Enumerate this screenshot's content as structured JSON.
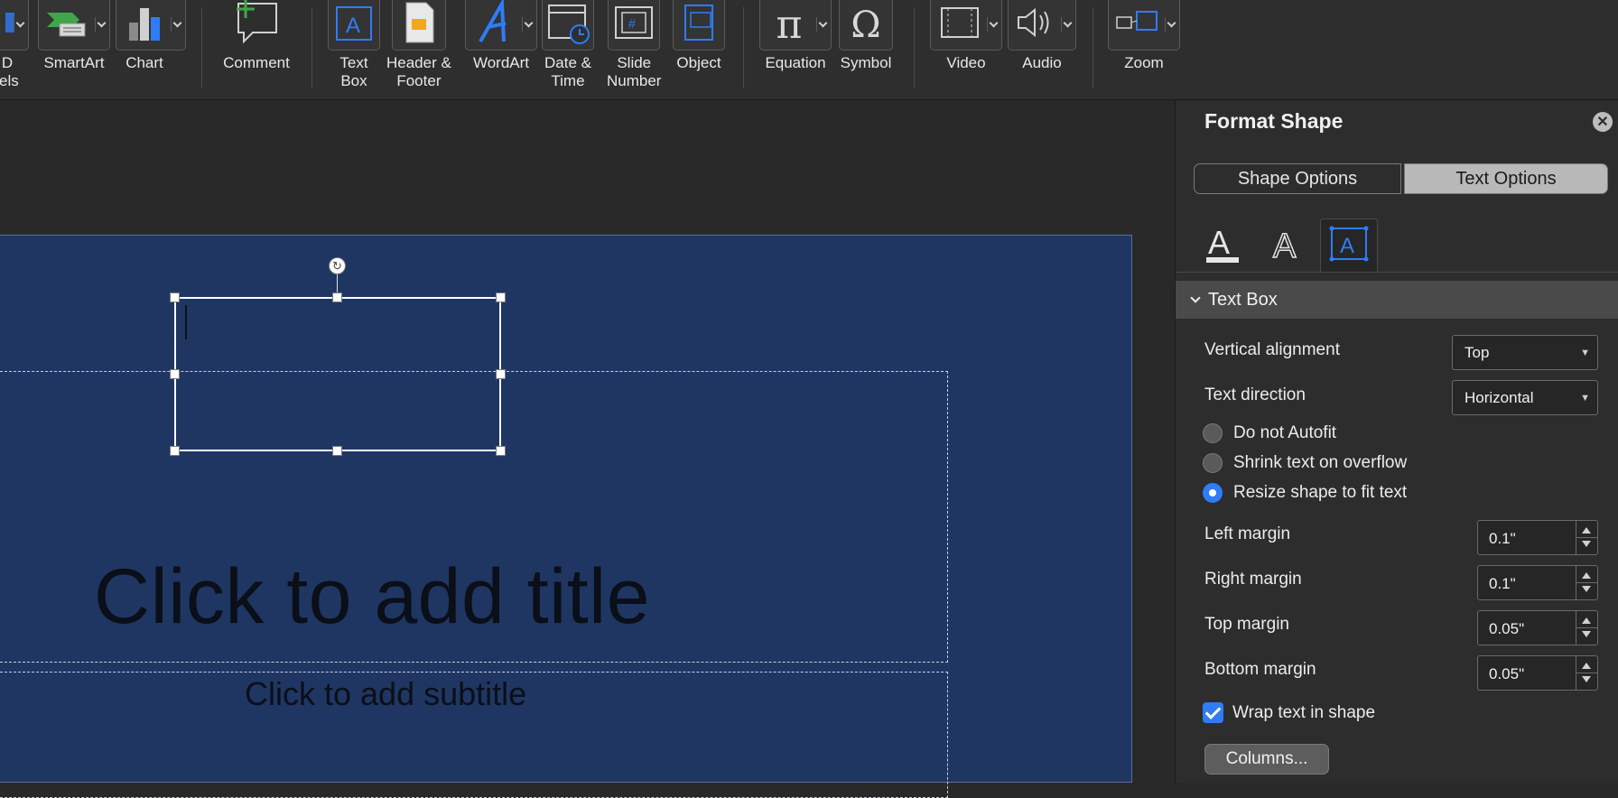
{
  "ribbon": {
    "items": [
      {
        "label": "D\nlels",
        "icon": "3d-models-icon"
      },
      {
        "label": "SmartArt",
        "icon": "smartart-icon"
      },
      {
        "label": "Chart",
        "icon": "chart-icon"
      },
      {
        "label": "Comment",
        "icon": "comment-icon"
      },
      {
        "label": "Text\nBox",
        "icon": "text-box-icon"
      },
      {
        "label": "Header &\nFooter",
        "icon": "header-footer-icon"
      },
      {
        "label": "WordArt",
        "icon": "wordart-icon"
      },
      {
        "label": "Date &\nTime",
        "icon": "date-time-icon"
      },
      {
        "label": "Slide\nNumber",
        "icon": "slide-number-icon"
      },
      {
        "label": "Object",
        "icon": "object-icon"
      },
      {
        "label": "Equation",
        "icon": "equation-icon"
      },
      {
        "label": "Symbol",
        "icon": "symbol-icon"
      },
      {
        "label": "Video",
        "icon": "video-icon"
      },
      {
        "label": "Audio",
        "icon": "audio-icon"
      },
      {
        "label": "Zoom",
        "icon": "zoom-icon"
      }
    ]
  },
  "slide": {
    "title_placeholder": "Click to add title",
    "subtitle_placeholder": "Click to add subtitle",
    "background_color": "#1f3663"
  },
  "pane": {
    "title": "Format Shape",
    "tabs": {
      "shape": "Shape Options",
      "text": "Text Options"
    },
    "section": "Text Box",
    "vertical_alignment": {
      "label": "Vertical alignment",
      "value": "Top"
    },
    "text_direction": {
      "label": "Text direction",
      "value": "Horizontal"
    },
    "autofit": {
      "options": [
        "Do not Autofit",
        "Shrink text on overflow",
        "Resize shape to fit text"
      ],
      "selected": "Resize shape to fit text"
    },
    "margins": [
      {
        "label": "Left margin",
        "value": "0.1\""
      },
      {
        "label": "Right margin",
        "value": "0.1\""
      },
      {
        "label": "Top margin",
        "value": "0.05\""
      },
      {
        "label": "Bottom margin",
        "value": "0.05\""
      }
    ],
    "wrap_text": {
      "label": "Wrap text in shape",
      "checked": true
    },
    "columns_button": "Columns...",
    "accent_color": "#2f7cf6"
  }
}
